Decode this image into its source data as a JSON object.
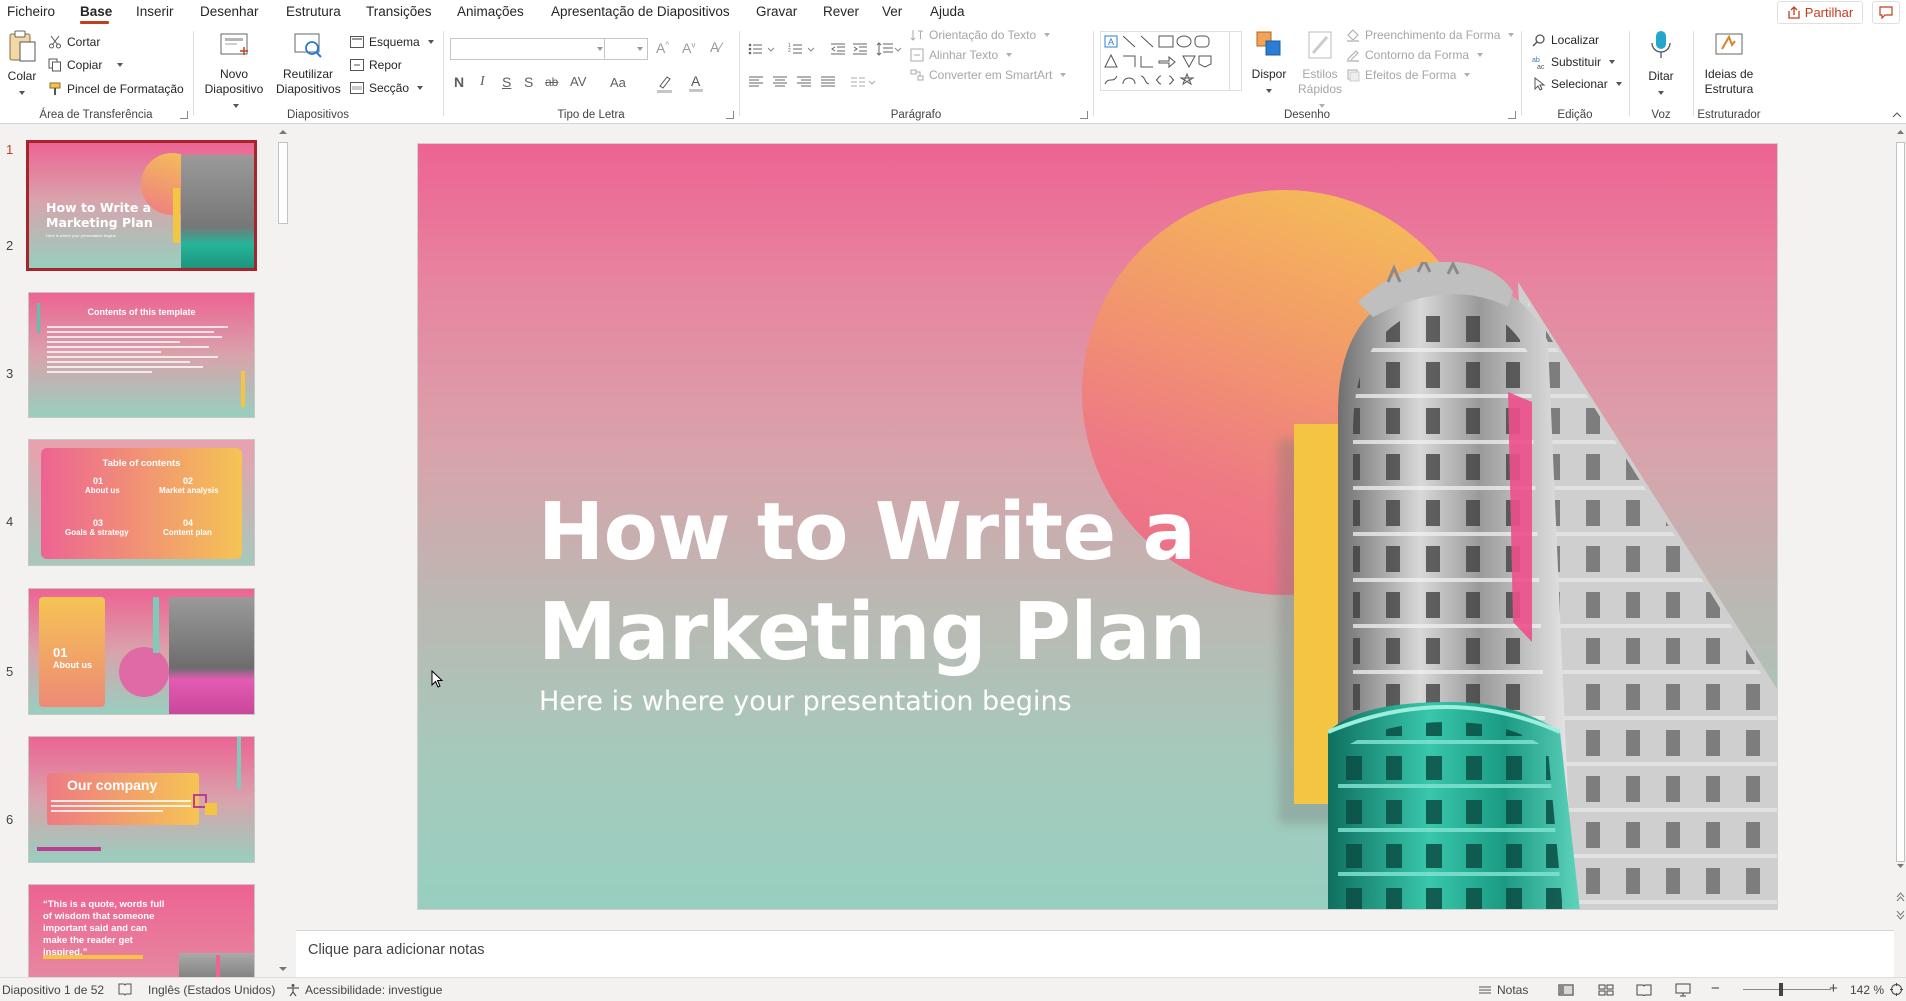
{
  "menu": {
    "tabs": [
      "Ficheiro",
      "Base",
      "Inserir",
      "Desenhar",
      "Estrutura",
      "Transições",
      "Animações",
      "Apresentação de Diapositivos",
      "Gravar",
      "Rever",
      "Ver",
      "Ajuda"
    ],
    "active_tab": "Base",
    "share_label": "Partilhar"
  },
  "ribbon": {
    "clipboard": {
      "label": "Área de Transferência",
      "paste": "Colar",
      "cut": "Cortar",
      "copy": "Copiar",
      "format_painter": "Pincel de Formatação"
    },
    "slides": {
      "label": "Diapositivos",
      "new_slide_1": "Novo",
      "new_slide_2": "Diapositivo",
      "reuse_1": "Reutilizar",
      "reuse_2": "Diapositivos",
      "layout": "Esquema",
      "reset": "Repor",
      "section": "Secção"
    },
    "font": {
      "label": "Tipo de Letra",
      "bold": "N",
      "italic": "I",
      "underline": "S",
      "shadow": "S",
      "strike": "ab",
      "spacing": "AV",
      "case": "Aa",
      "color": "A"
    },
    "paragraph": {
      "label": "Parágrafo",
      "text_direction": "Orientação do Texto",
      "align_text": "Alinhar Texto",
      "smartart": "Converter em SmartArt"
    },
    "drawing": {
      "label": "Desenho",
      "arrange": "Dispor",
      "quick_styles_1": "Estilos",
      "quick_styles_2": "Rápidos",
      "fill": "Preenchimento da Forma",
      "outline": "Contorno da Forma",
      "effects": "Efeitos de Forma"
    },
    "editing": {
      "label": "Edição",
      "find": "Localizar",
      "replace": "Substituir",
      "select": "Selecionar"
    },
    "voice": {
      "label": "Voz",
      "dictate": "Ditar"
    },
    "designer": {
      "label": "Estruturador",
      "ideas_1": "Ideias de",
      "ideas_2": "Estrutura"
    }
  },
  "thumbnails": [
    {
      "num": "1",
      "title": "How to Write a Marketing Plan",
      "sub": "Here is where your presentation begins"
    },
    {
      "num": "2",
      "title": "Contents of this template"
    },
    {
      "num": "3",
      "title": "Table of contents",
      "items": [
        {
          "n": "01",
          "t": "About us"
        },
        {
          "n": "02",
          "t": "Market analysis"
        },
        {
          "n": "03",
          "t": "Goals & strategy"
        },
        {
          "n": "04",
          "t": "Content plan"
        }
      ]
    },
    {
      "num": "4",
      "n": "01",
      "title": "About us"
    },
    {
      "num": "5",
      "title": "Our company"
    },
    {
      "num": "6",
      "quote": "“This is a quote, words full of wisdom that someone important said and can make the reader get inspired.”"
    }
  ],
  "slide": {
    "title_line1": "How to Write a",
    "title_line2": "Marketing Plan",
    "subtitle": "Here is where your presentation begins"
  },
  "notes_placeholder": "Clique para adicionar notas",
  "status": {
    "slide_counter": "Diapositivo 1 de 52",
    "language": "Inglês (Estados Unidos)",
    "accessibility": "Acessibilidade: investigue",
    "notes": "Notas",
    "zoom": "142 %"
  },
  "colors": {
    "accent": "#c43e1c",
    "slide_top": "#ed6393",
    "slide_bottom": "#97cfbf",
    "yellow": "#f4c542",
    "teal": "#26b59a"
  }
}
